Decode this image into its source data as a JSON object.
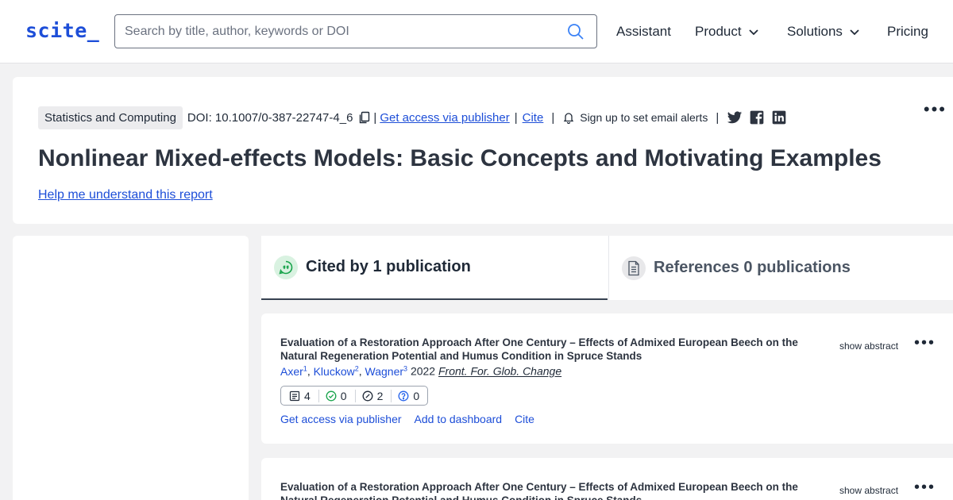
{
  "header": {
    "logo": "scite_",
    "search_placeholder": "Search by title, author, keywords or DOI",
    "nav": {
      "assistant": "Assistant",
      "product": "Product",
      "solutions": "Solutions",
      "pricing": "Pricing"
    }
  },
  "report": {
    "journal": "Statistics and Computing",
    "doi": "DOI: 10.1007/0-387-22747-4_6",
    "access_link": "Get access via publisher",
    "cite_link": "Cite",
    "alerts": "Sign up to set email alerts",
    "title": "Nonlinear Mixed-effects Models: Basic Concepts and Motivating Examples",
    "help_link": "Help me understand this report"
  },
  "tabs": {
    "cited_by": "Cited by 1 publication",
    "references": "References 0 publications"
  },
  "citations": [
    {
      "title": "Evaluation of a Restoration Approach After One Century – Effects of Admixed European Beech on the Natural Regeneration Potential and Humus Condition in Spruce Stands",
      "authors": [
        {
          "name": "Axer",
          "sup": "1"
        },
        {
          "name": "Kluckow",
          "sup": "2"
        },
        {
          "name": "Wagner",
          "sup": "3"
        }
      ],
      "year": "2022",
      "journal": "Front. For. Glob. Change",
      "show_abstract": "show abstract",
      "badges": {
        "publications": "4",
        "supporting": "0",
        "mentioning": "2",
        "contrasting": "0"
      },
      "actions": {
        "access": "Get access via publisher",
        "dashboard": "Add to dashboard",
        "cite": "Cite"
      }
    },
    {
      "title": "Evaluation of a Restoration Approach After One Century – Effects of Admixed European Beech on the Natural Regeneration Potential and Humus Condition in Spruce Stands",
      "show_abstract": "show abstract"
    }
  ],
  "colors": {
    "brand": "#1d4ed8",
    "background": "#f2f2f3",
    "supporting": "#16a34a",
    "contrasting": "#2563eb"
  }
}
